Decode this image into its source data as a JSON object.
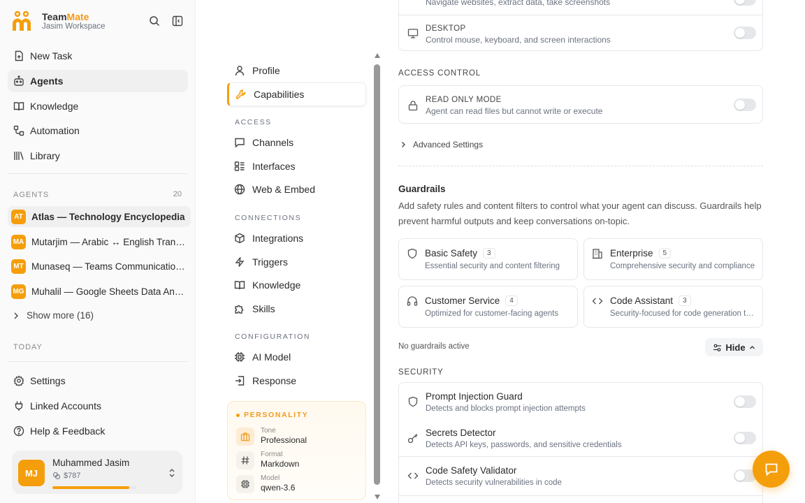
{
  "app": {
    "brand_first": "Team",
    "brand_second": "Mate",
    "workspace": "Jasim Workspace"
  },
  "sidebar": {
    "nav": [
      {
        "label": "New Task",
        "icon": "new-task-icon"
      },
      {
        "label": "Agents",
        "icon": "agents-icon"
      },
      {
        "label": "Knowledge",
        "icon": "book-icon"
      },
      {
        "label": "Automation",
        "icon": "automation-icon"
      },
      {
        "label": "Library",
        "icon": "library-icon"
      }
    ],
    "agents_label": "AGENTS",
    "agents_count": "20",
    "agents": [
      {
        "initials": "AT",
        "name": "Atlas — Technology Encyclopedia"
      },
      {
        "initials": "MA",
        "name": "Mutarjim — Arabic ↔ English Translator"
      },
      {
        "initials": "MT",
        "name": "Munaseq — Teams Communication Assistant"
      },
      {
        "initials": "MG",
        "name": "Muhalil — Google Sheets Data Analyst"
      }
    ],
    "show_more": "Show more (16)",
    "today_label": "TODAY",
    "bottom": [
      {
        "label": "Settings",
        "icon": "gear-icon"
      },
      {
        "label": "Linked Accounts",
        "icon": "plug-icon"
      },
      {
        "label": "Help & Feedback",
        "icon": "help-icon"
      }
    ],
    "user": {
      "initials": "MJ",
      "name": "Muhammed Jasim",
      "credit": "$787",
      "credit_fraction": 0.92
    }
  },
  "settings_nav": {
    "top": [
      {
        "label": "Profile"
      },
      {
        "label": "Capabilities"
      }
    ],
    "access_label": "ACCESS",
    "access": [
      {
        "label": "Channels"
      },
      {
        "label": "Interfaces"
      },
      {
        "label": "Web & Embed"
      }
    ],
    "connections_label": "CONNECTIONS",
    "connections": [
      {
        "label": "Integrations"
      },
      {
        "label": "Triggers"
      },
      {
        "label": "Knowledge"
      },
      {
        "label": "Skills"
      }
    ],
    "configuration_label": "CONFIGURATION",
    "configuration": [
      {
        "label": "AI Model"
      },
      {
        "label": "Response"
      }
    ],
    "personality": {
      "title": "PERSONALITY",
      "tone_label": "Tone",
      "tone_value": "Professional",
      "format_label": "Format",
      "format_value": "Markdown",
      "model_label": "Model",
      "model_value": "qwen-3.6"
    }
  },
  "main": {
    "browser_desc": "Navigate websites, extract data, take screenshots",
    "desktop_title": "DESKTOP",
    "desktop_desc": "Control mouse, keyboard, and screen interactions",
    "access_control_label": "ACCESS CONTROL",
    "readonly_title": "READ ONLY MODE",
    "readonly_desc": "Agent can read files but cannot write or execute",
    "advanced": "Advanced Settings",
    "guardrails_title": "Guardrails",
    "guardrails_desc": "Add safety rules and content filters to control what your agent can discuss. Guardrails help prevent harmful outputs and keep conversations on-topic.",
    "presets": [
      {
        "name": "Basic Safety",
        "count": "3",
        "desc": "Essential security and content filtering"
      },
      {
        "name": "Enterprise",
        "count": "5",
        "desc": "Comprehensive security and compliance"
      },
      {
        "name": "Customer Service",
        "count": "4",
        "desc": "Optimized for customer-facing agents"
      },
      {
        "name": "Code Assistant",
        "count": "3",
        "desc": "Security-focused for code generation tasks"
      }
    ],
    "no_guardrails": "No guardrails active",
    "hide_label": "Hide",
    "security_label": "SECURITY",
    "security": [
      {
        "title": "Prompt Injection Guard",
        "desc": "Detects and blocks prompt injection attempts"
      },
      {
        "title": "Secrets Detector",
        "desc": "Detects API keys, passwords, and sensitive credentials"
      },
      {
        "title": "Code Safety Validator",
        "desc": "Detects security vulnerabilities in code"
      }
    ]
  },
  "colors": {
    "accent": "#f59e0b",
    "accent_text": "#f39a1e"
  }
}
